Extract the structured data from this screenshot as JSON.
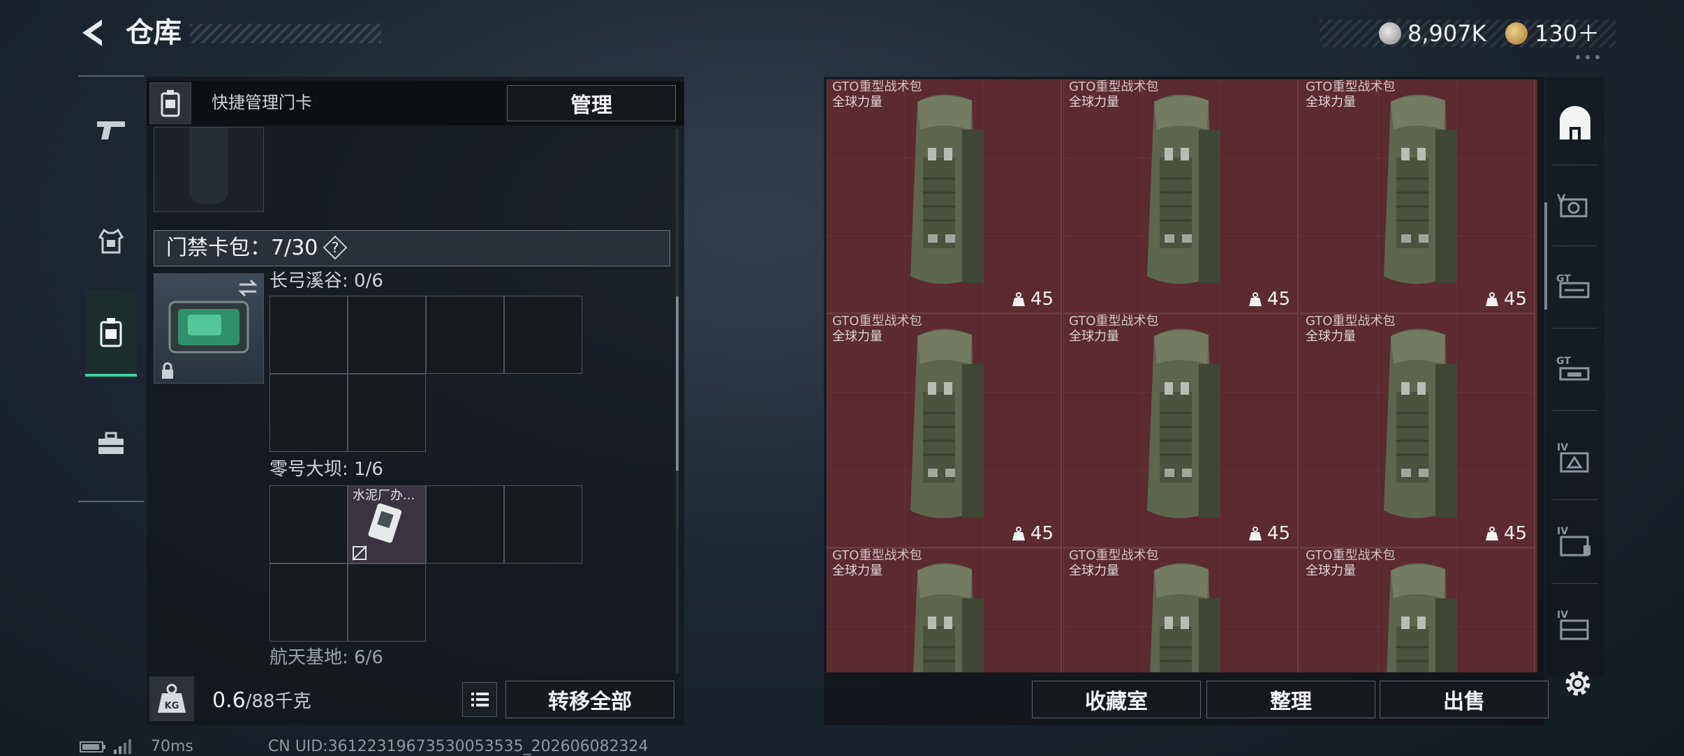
{
  "header": {
    "title": "仓库"
  },
  "currency": [
    {
      "icon": "silver-coin-icon",
      "value": "8,907K"
    },
    {
      "icon": "gold-coin-icon",
      "value": "130＋"
    }
  ],
  "left_nav": [
    {
      "name": "weapons-tab",
      "icon": "pistol-icon"
    },
    {
      "name": "equipment-tab",
      "icon": "armor-icon"
    },
    {
      "name": "keycard-tab",
      "icon": "keycard-icon",
      "active": true
    },
    {
      "name": "tools-tab",
      "icon": "toolbox-icon"
    }
  ],
  "quick_manage": {
    "label": "快捷管理门卡",
    "button": "管理"
  },
  "card_bag": {
    "label": "门禁卡包：7/30",
    "help": "?"
  },
  "zones": [
    {
      "label": "长弓溪谷: 0/6"
    },
    {
      "label": "零号大坝: 1/6",
      "item": "水泥厂办..."
    },
    {
      "label": "航天基地: 6/6"
    }
  ],
  "weight": {
    "current": "0.6",
    "max": "/88千克"
  },
  "transfer_all": "转移全部",
  "items": [
    {
      "name": "GTO重型战术包",
      "sub": "全球力量",
      "count": "45"
    },
    {
      "name": "GTO重型战术包",
      "sub": "全球力量",
      "count": "45"
    },
    {
      "name": "GTO重型战术包",
      "sub": "全球力量",
      "count": "45"
    },
    {
      "name": "GTO重型战术包",
      "sub": "全球力量",
      "count": "45"
    },
    {
      "name": "GTO重型战术包",
      "sub": "全球力量",
      "count": "45"
    },
    {
      "name": "GTO重型战术包",
      "sub": "全球力量",
      "count": "45"
    },
    {
      "name": "GTO重型战术包",
      "sub": "全球力量",
      "count": ""
    },
    {
      "name": "GTO重型战术包",
      "sub": "全球力量",
      "count": ""
    },
    {
      "name": "GTO重型战术包",
      "sub": "全球力量",
      "count": ""
    }
  ],
  "actions": {
    "collection": "收藏室",
    "arrange": "整理",
    "sell": "出售"
  },
  "right_tabs": [
    "home-tab",
    "v-tab",
    "gt-tab-1",
    "gt-tab-2",
    "iv-tab-1",
    "iv-tab-2",
    "iv-tab-3"
  ],
  "status": {
    "ping": "70ms",
    "uid": "CN UID:36122319673530053535_202606082324"
  },
  "colors": {
    "accent": "#3ad6a0",
    "item_bg": "#5c2a31"
  }
}
